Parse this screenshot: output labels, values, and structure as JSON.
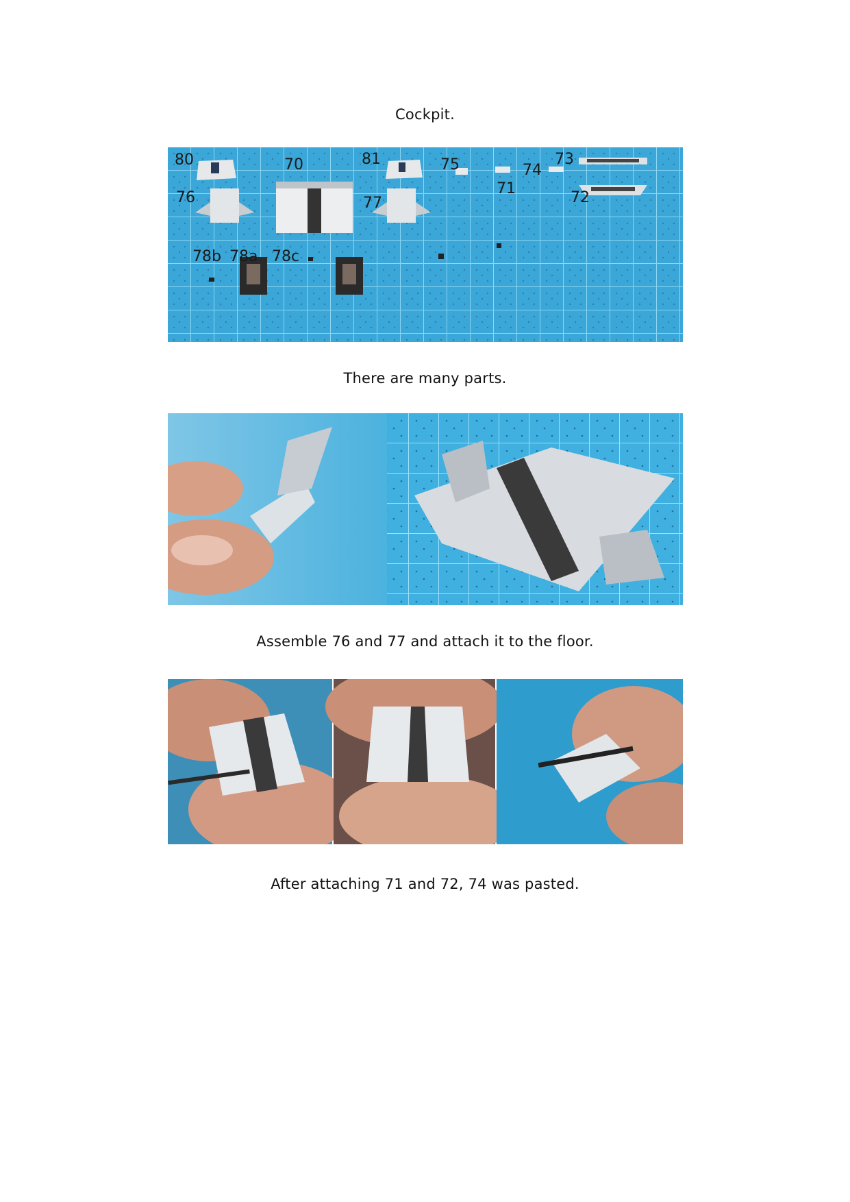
{
  "title": "Cockpit.",
  "photo1": {
    "part_labels": [
      "80",
      "70",
      "81",
      "75",
      "73",
      "74",
      "71",
      "72",
      "76",
      "77",
      "78b",
      "78a",
      "78c"
    ]
  },
  "caption1": "There are many parts.",
  "caption2": "Assemble 76 and 77 and attach it to the floor.",
  "caption3": "After attaching 71 and 72, 74 was pasted.",
  "colors": {
    "mat": "#3aa7d8",
    "grid": "#7fd0f0",
    "skin": "#d9a48a",
    "paper": "#e7e9ec",
    "ink": "#2b2b2b"
  }
}
